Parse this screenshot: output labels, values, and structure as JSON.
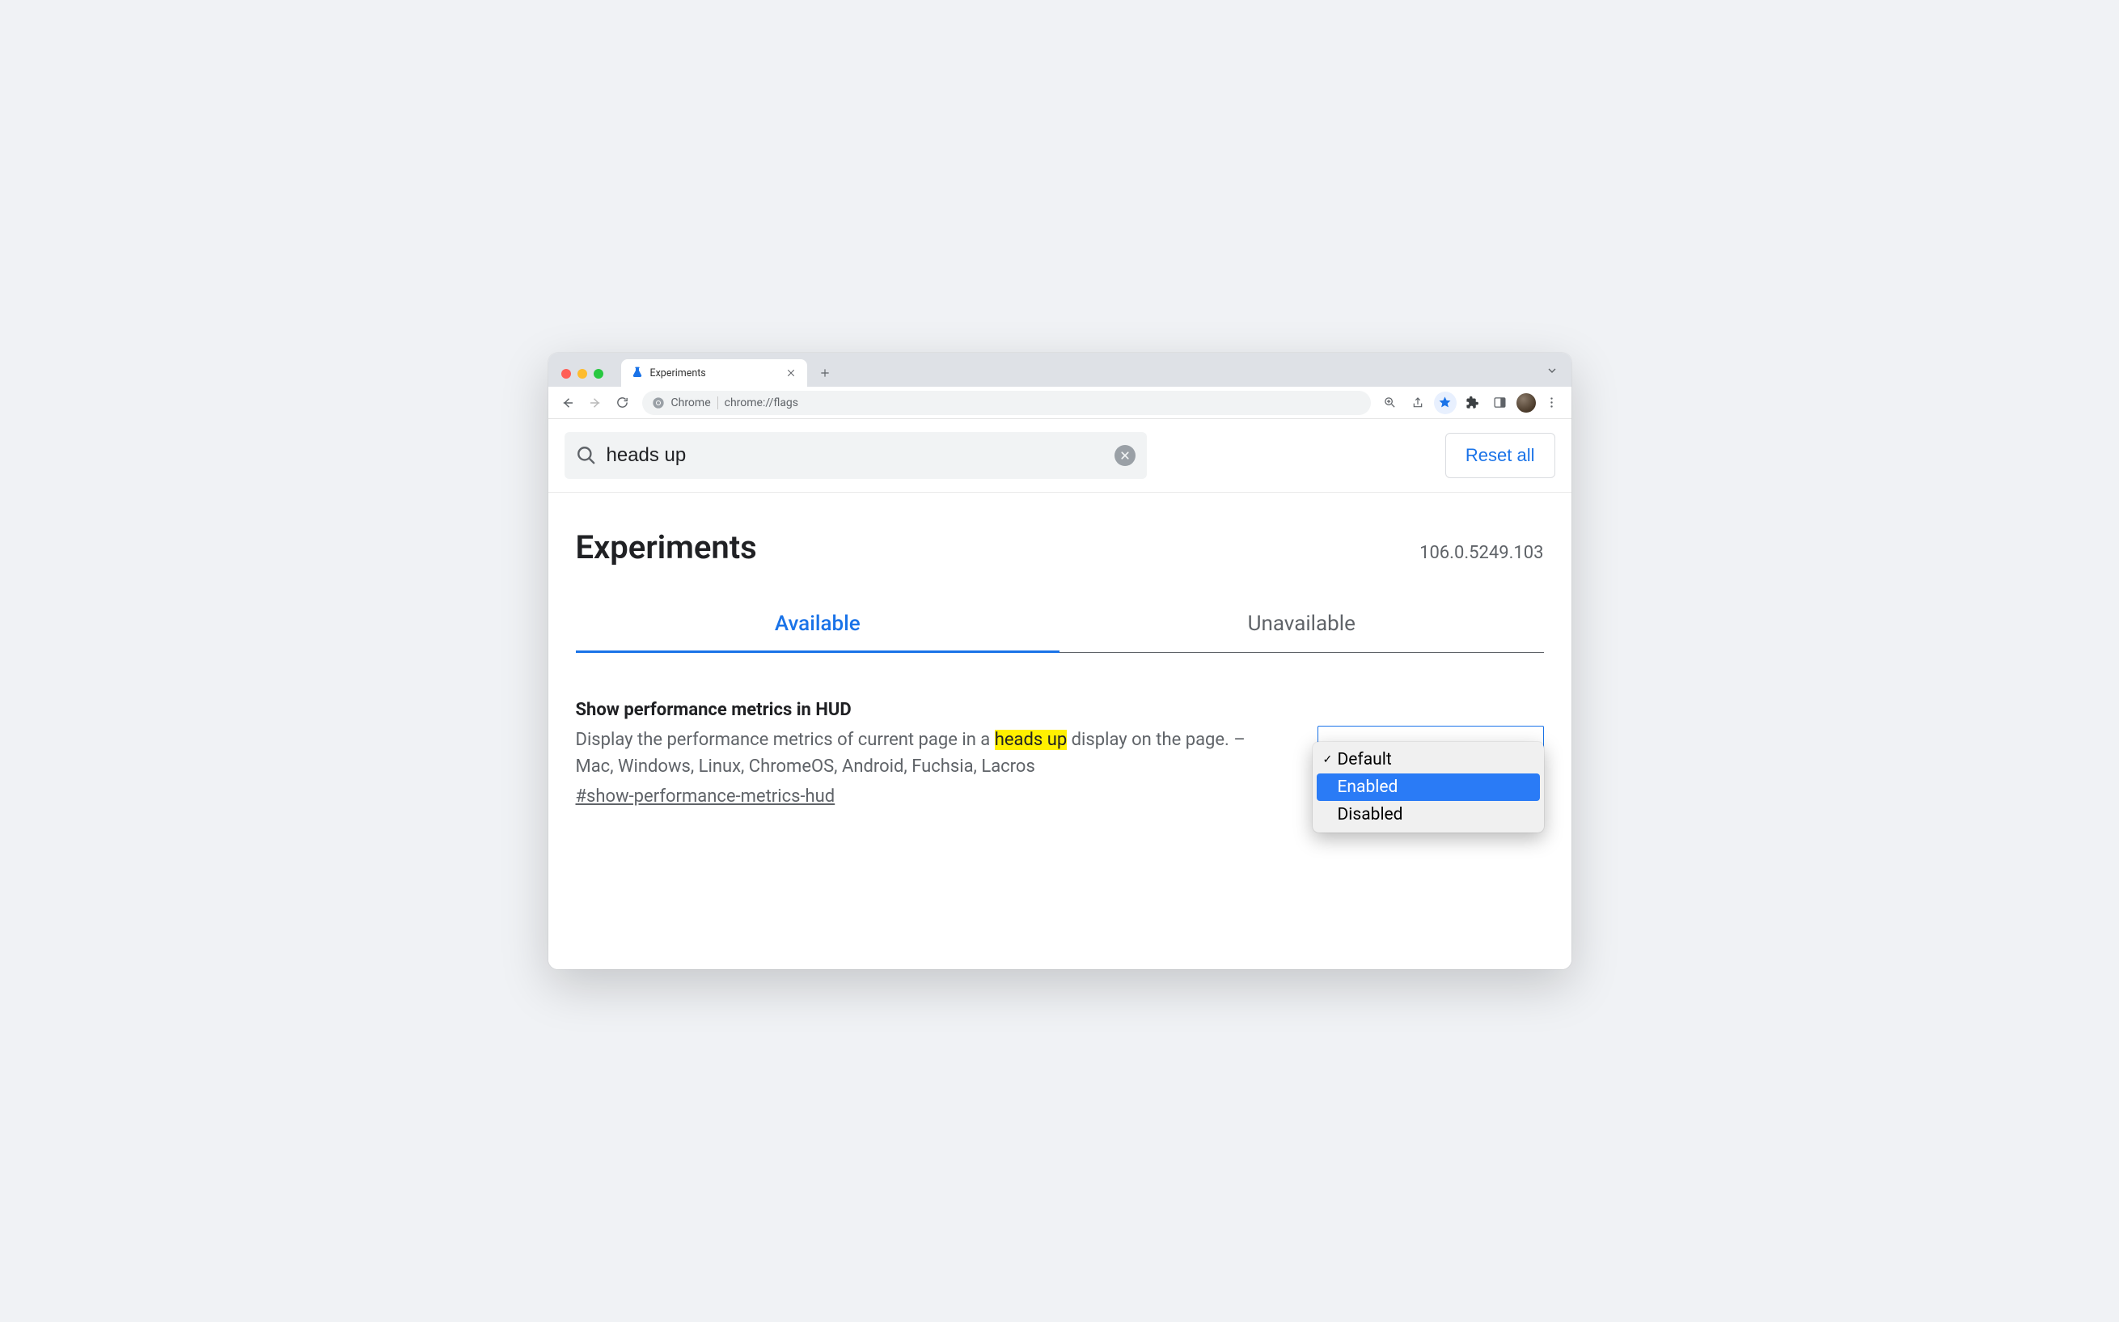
{
  "browser": {
    "tab": {
      "title": "Experiments"
    },
    "address": {
      "prefix": "Chrome",
      "url": "chrome://flags"
    }
  },
  "search": {
    "value": "heads up"
  },
  "reset_button_label": "Reset all",
  "page": {
    "title": "Experiments",
    "version": "106.0.5249.103"
  },
  "tabs": {
    "available": "Available",
    "unavailable": "Unavailable"
  },
  "experiment": {
    "title": "Show performance metrics in HUD",
    "desc_before": "Display the performance metrics of current page in a ",
    "desc_highlight": "heads up",
    "desc_after": " display on the page. – Mac, Windows, Linux, ChromeOS, Android, Fuchsia, Lacros",
    "tag": "#show-performance-metrics-hud",
    "dropdown": {
      "options": {
        "default": "Default",
        "enabled": "Enabled",
        "disabled": "Disabled"
      }
    }
  }
}
